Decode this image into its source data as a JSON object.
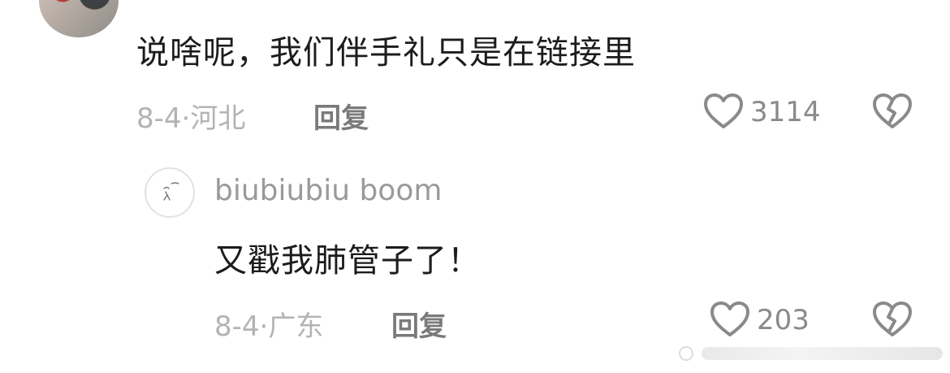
{
  "comment": {
    "text": "说啥呢，我们伴手礼只是在链接里",
    "date": "8-4",
    "separator": "·",
    "location": "河北",
    "reply_label": "回复",
    "like_count": "3114"
  },
  "reply": {
    "username": "biubiubiu boom",
    "text": "又戳我肺管子了！",
    "date": "8-4",
    "separator": "·",
    "location": "广东",
    "reply_label": "回复",
    "like_count": "203"
  },
  "icons": {
    "like": "heart-outline-icon",
    "dislike": "broken-heart-icon"
  },
  "colors": {
    "text_primary": "#1c1c1c",
    "text_meta": "#b3b3b3",
    "icon": "#8a8a8a"
  }
}
